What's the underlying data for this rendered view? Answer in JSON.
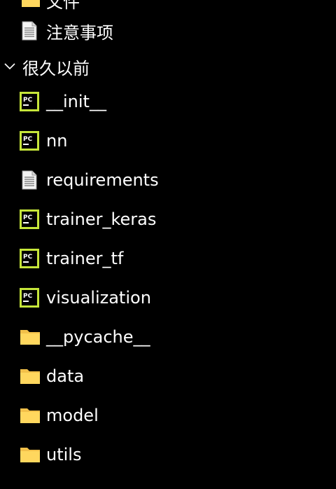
{
  "colors": {
    "background": "#000000",
    "text": "#ffffff",
    "pycharm_icon": "#c6e63a",
    "folder_icon": "#ffd75e"
  },
  "tree": {
    "partial_item": {
      "label": "文件",
      "icon": "folder-icon"
    },
    "note_item": {
      "label": "注意事项",
      "icon": "text-file-icon"
    },
    "group": {
      "label": "很久以前",
      "expanded": true,
      "items": [
        {
          "label": "__init__",
          "icon": "pycharm-file-icon"
        },
        {
          "label": "nn",
          "icon": "pycharm-file-icon"
        },
        {
          "label": "requirements",
          "icon": "text-file-icon"
        },
        {
          "label": "trainer_keras",
          "icon": "pycharm-file-icon"
        },
        {
          "label": "trainer_tf",
          "icon": "pycharm-file-icon"
        },
        {
          "label": "visualization",
          "icon": "pycharm-file-icon"
        },
        {
          "label": "__pycache__",
          "icon": "folder-icon"
        },
        {
          "label": "data",
          "icon": "folder-icon"
        },
        {
          "label": "model",
          "icon": "folder-icon"
        },
        {
          "label": "utils",
          "icon": "folder-icon"
        }
      ]
    }
  }
}
